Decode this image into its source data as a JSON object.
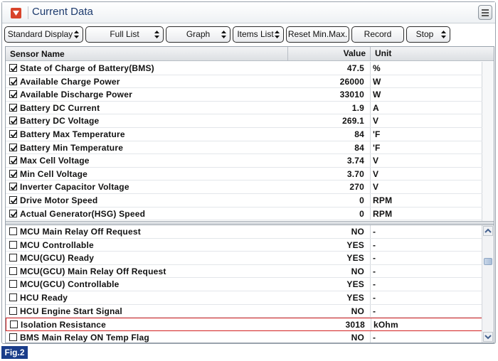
{
  "window": {
    "title": "Current Data"
  },
  "toolbar": {
    "buttons": [
      "Standard Display",
      "Full List",
      "Graph",
      "Items List",
      "Reset Min.Max.",
      "Record",
      "Stop"
    ]
  },
  "table": {
    "headers": {
      "name": "Sensor Name",
      "value": "Value",
      "unit": "Unit"
    },
    "fixed_rows": [
      {
        "name": "State of Charge of Battery(BMS)",
        "value": "47.5",
        "unit": "%",
        "checked": true
      },
      {
        "name": "Available Charge Power",
        "value": "26000",
        "unit": "W",
        "checked": true
      },
      {
        "name": "Available Discharge Power",
        "value": "33010",
        "unit": "W",
        "checked": true
      },
      {
        "name": "Battery DC Current",
        "value": "1.9",
        "unit": "A",
        "checked": true
      },
      {
        "name": "Battery DC Voltage",
        "value": "269.1",
        "unit": "V",
        "checked": true
      },
      {
        "name": "Battery Max Temperature",
        "value": "84",
        "unit": "'F",
        "checked": true
      },
      {
        "name": "Battery Min Temperature",
        "value": "84",
        "unit": "'F",
        "checked": true
      },
      {
        "name": "Max Cell Voltage",
        "value": "3.74",
        "unit": "V",
        "checked": true
      },
      {
        "name": "Min Cell Voltage",
        "value": "3.70",
        "unit": "V",
        "checked": true
      },
      {
        "name": "Inverter Capacitor Voltage",
        "value": "270",
        "unit": "V",
        "checked": true
      },
      {
        "name": "Drive Motor Speed",
        "value": "0",
        "unit": "RPM",
        "checked": true
      },
      {
        "name": "Actual Generator(HSG) Speed",
        "value": "0",
        "unit": "RPM",
        "checked": true
      }
    ],
    "scroll_rows": [
      {
        "name": "MCU Main Relay Off Request",
        "value": "NO",
        "unit": "-",
        "checked": false
      },
      {
        "name": "MCU Controllable",
        "value": "YES",
        "unit": "-",
        "checked": false
      },
      {
        "name": "MCU(GCU) Ready",
        "value": "YES",
        "unit": "-",
        "checked": false
      },
      {
        "name": "MCU(GCU) Main Relay Off Request",
        "value": "NO",
        "unit": "-",
        "checked": false
      },
      {
        "name": "MCU(GCU) Controllable",
        "value": "YES",
        "unit": "-",
        "checked": false
      },
      {
        "name": "HCU Ready",
        "value": "YES",
        "unit": "-",
        "checked": false
      },
      {
        "name": "HCU Engine Start Signal",
        "value": "NO",
        "unit": "-",
        "checked": false
      },
      {
        "name": "Isolation Resistance",
        "value": "3018",
        "unit": "kOhm",
        "checked": false,
        "highlighted": true
      },
      {
        "name": "BMS Main Relay ON Temp Flag",
        "value": "NO",
        "unit": "-",
        "checked": false
      }
    ]
  },
  "figure_label": "Fig.2",
  "colors": {
    "title": "#1d3b6e",
    "highlight_border": "#d32020",
    "fig_label_bg": "#1a3d8a",
    "title_icon": "#d8442b"
  }
}
